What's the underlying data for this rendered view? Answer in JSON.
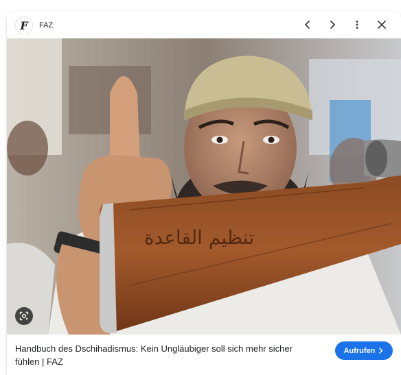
{
  "source": {
    "logo_letter": "F",
    "name": "FAZ"
  },
  "header": {
    "prev_icon": "chevron-left-icon",
    "next_icon": "chevron-right-icon",
    "more_icon": "more-vert-icon",
    "close_icon": "close-icon"
  },
  "image": {
    "stock_engraving": "تنظيم القاعدة",
    "lens_icon": "lens-icon"
  },
  "result": {
    "title": "Handbuch des Dschihadismus: Kein Ungläubiger soll sich mehr sicher fühlen | FAZ",
    "visit_label": "Aufrufen",
    "visit_icon": "chevron-right-icon"
  },
  "colors": {
    "accent": "#1a73e8",
    "text": "#202124"
  }
}
